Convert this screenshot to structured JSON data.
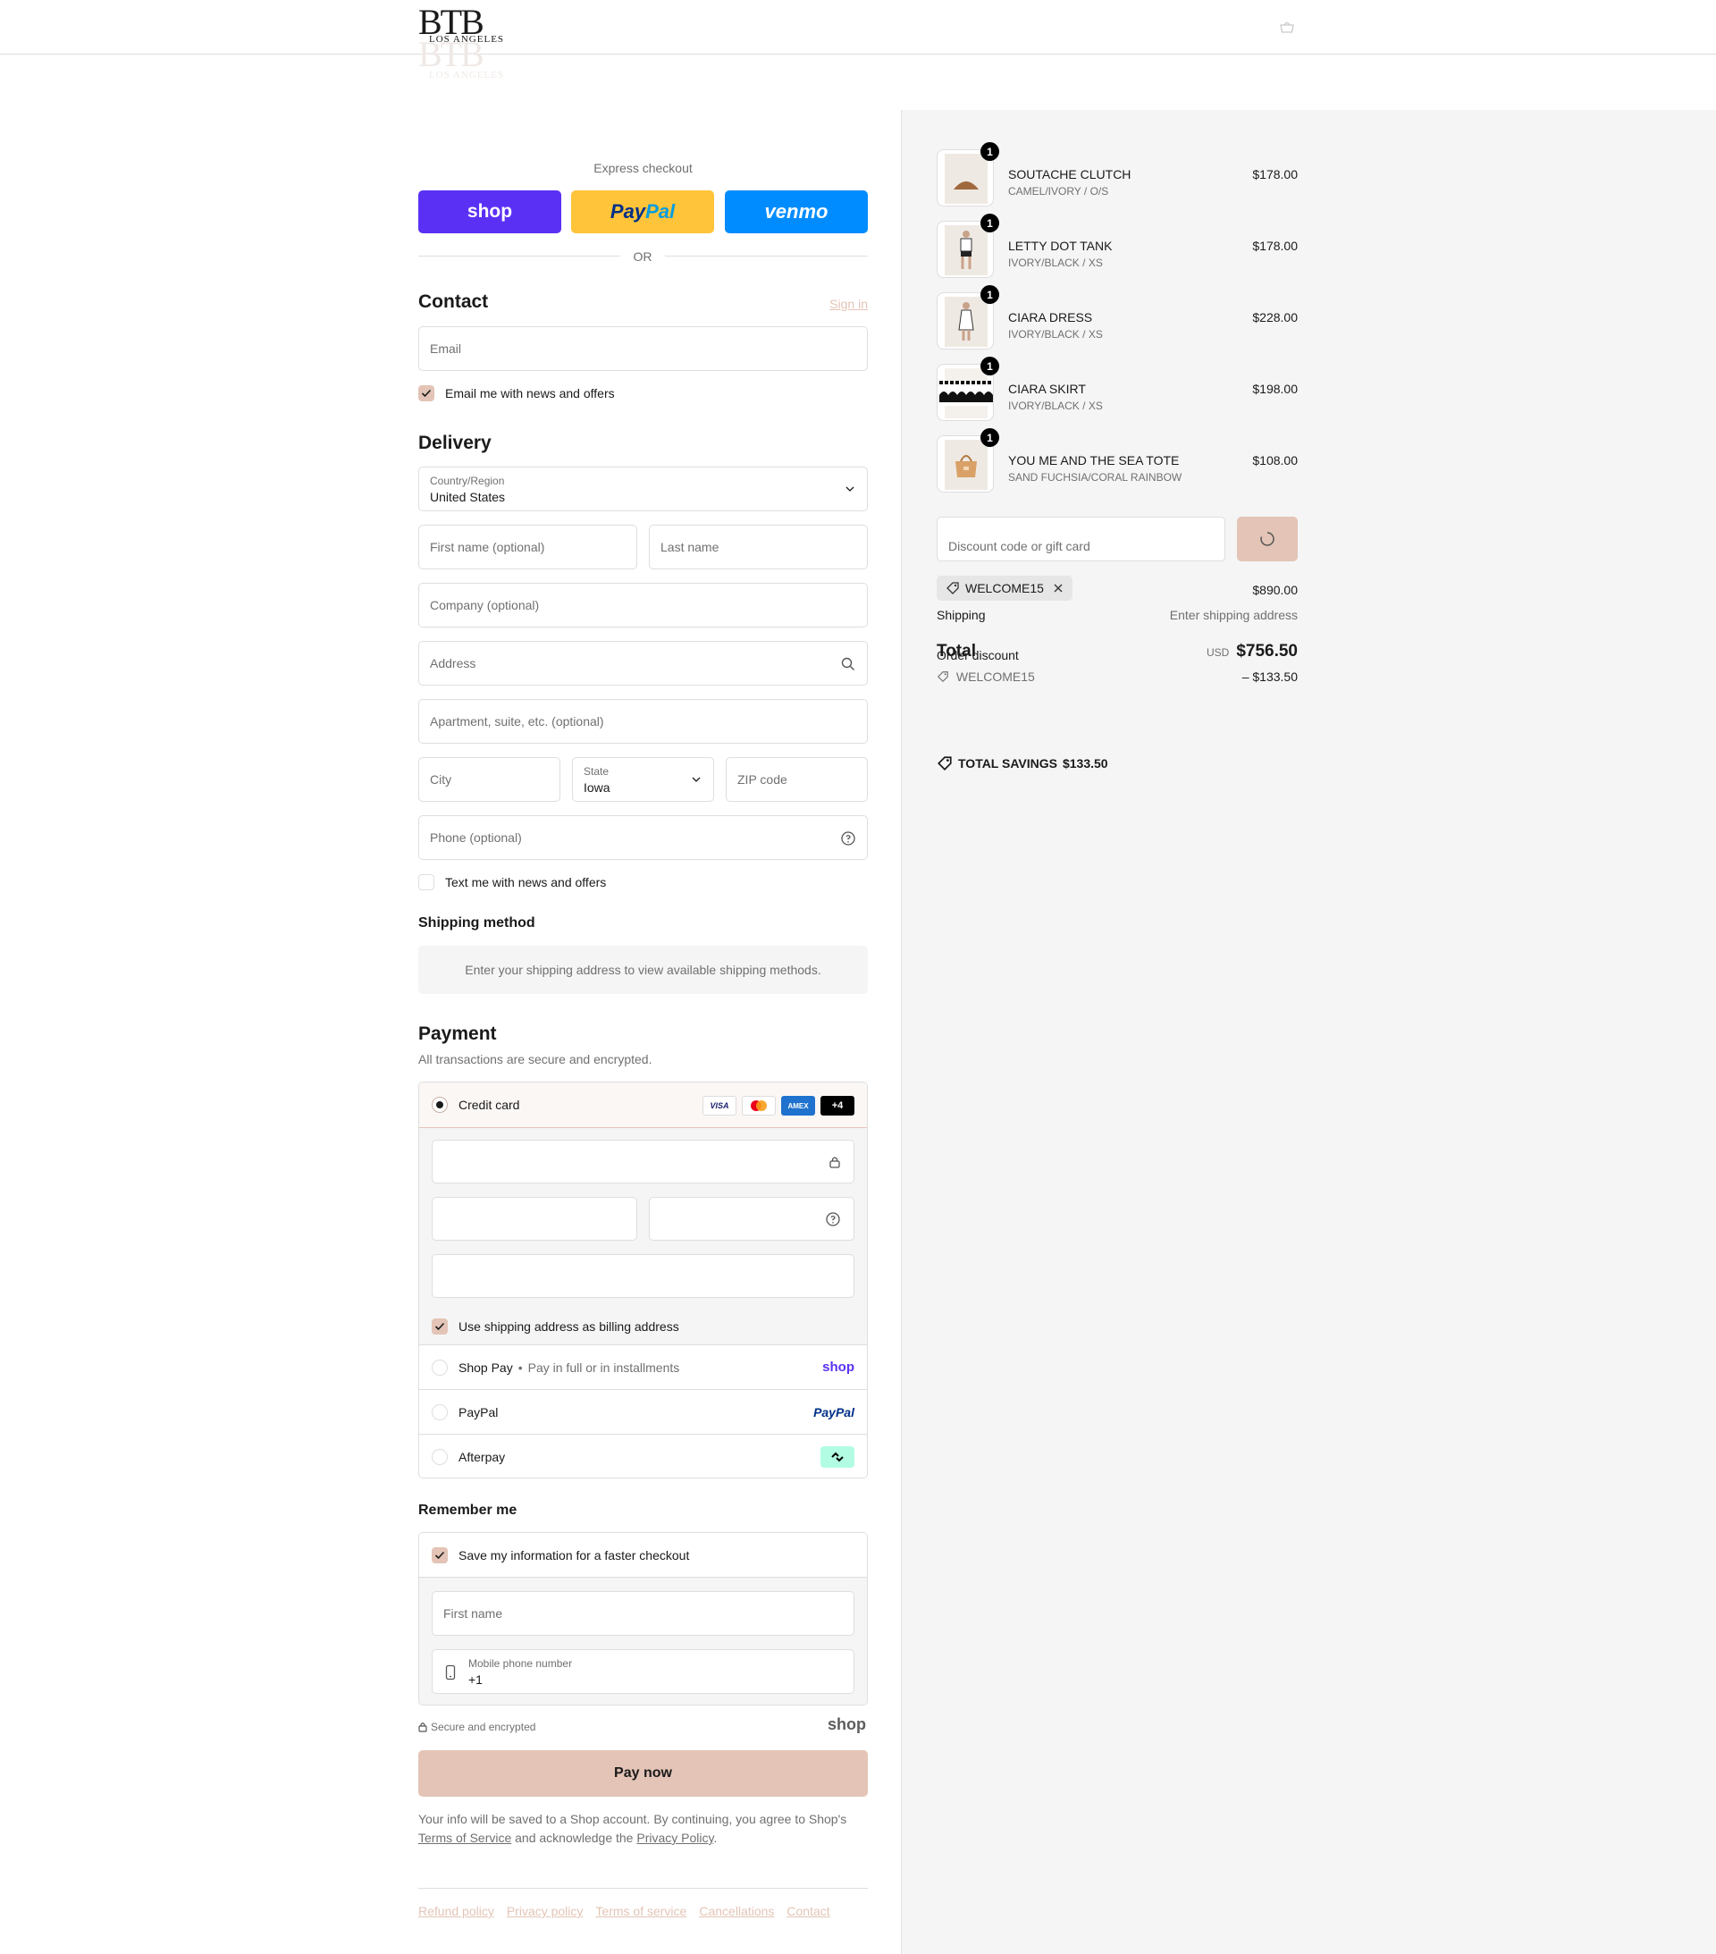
{
  "brand": {
    "logo_big": "BTB",
    "logo_small": "LOS ANGELES"
  },
  "express": {
    "title": "Express checkout",
    "shop": "shop",
    "paypal_a": "Pay",
    "paypal_b": "Pal",
    "venmo": "venmo",
    "or": "OR"
  },
  "contact": {
    "title": "Contact",
    "sign_in": "Sign in",
    "email_placeholder": "Email",
    "newsletter": "Email me with news and offers"
  },
  "delivery": {
    "title": "Delivery",
    "country_label": "Country/Region",
    "country_value": "United States",
    "first_name": "First name (optional)",
    "last_name": "Last name",
    "company": "Company (optional)",
    "address": "Address",
    "apartment": "Apartment, suite, etc. (optional)",
    "city": "City",
    "state_label": "State",
    "state_value": "Iowa",
    "zip": "ZIP code",
    "phone": "Phone (optional)",
    "sms": "Text me with news and offers"
  },
  "shipping": {
    "title": "Shipping method",
    "info": "Enter your shipping address to view available shipping methods."
  },
  "payment": {
    "title": "Payment",
    "desc": "All transactions are secure and encrypted.",
    "credit_card": "Credit card",
    "card_visa": "VISA",
    "card_amex": "AMEX",
    "card_more": "+4",
    "billing_same": "Use shipping address as billing address",
    "shop_pay": "Shop Pay",
    "shop_pay_sub": "Pay in full or in installments",
    "shop_pay_logo": "shop",
    "paypal": "PayPal",
    "paypal_logo": "PayPal",
    "afterpay": "Afterpay"
  },
  "remember": {
    "title": "Remember me",
    "save_info": "Save my information for a faster checkout",
    "first_name": "First name",
    "mobile_label": "Mobile phone number",
    "mobile_value": "+1"
  },
  "secure": {
    "text": "Secure and encrypted",
    "shop": "shop"
  },
  "pay_now": "Pay now",
  "legal": {
    "a": "Your info will be saved to a Shop account. By continuing, you agree to Shop's",
    "terms": "Terms of Service",
    "b": "and acknowledge the",
    "privacy": "Privacy Policy",
    "c": "."
  },
  "footer": [
    "Refund policy",
    "Privacy policy",
    "Terms of service",
    "Cancellations",
    "Contact"
  ],
  "cart": {
    "items": [
      {
        "qty": "1",
        "name": "SOUTACHE CLUTCH",
        "variant": "CAMEL/IVORY / O/S",
        "price": "$178.00"
      },
      {
        "qty": "1",
        "name": "LETTY DOT TANK",
        "variant": "IVORY/BLACK / XS",
        "price": "$178.00"
      },
      {
        "qty": "1",
        "name": "CIARA DRESS",
        "variant": "IVORY/BLACK / XS",
        "price": "$228.00"
      },
      {
        "qty": "1",
        "name": "CIARA SKIRT",
        "variant": "IVORY/BLACK / XS",
        "price": "$198.00"
      },
      {
        "qty": "1",
        "name": "YOU ME AND THE SEA TOTE",
        "variant": "SAND FUCHSIA/CORAL RAINBOW",
        "price": "$108.00"
      }
    ],
    "discount_placeholder": "Discount code or gift card",
    "code": "WELCOME15",
    "subtotal": "$890.00",
    "shipping_label": "Shipping",
    "shipping_value": "Enter shipping address",
    "order_discount": "Order discount",
    "discount_code": "WELCOME15",
    "discount_value": "– $133.50",
    "total_label": "Total",
    "currency": "USD",
    "total": "$756.50",
    "savings_label": "TOTAL SAVINGS",
    "savings_value": "$133.50"
  },
  "colors": {
    "accent": "#e3c4b6",
    "shop": "#5a31f4",
    "paypal": "#ffc439",
    "venmo": "#008cff"
  }
}
